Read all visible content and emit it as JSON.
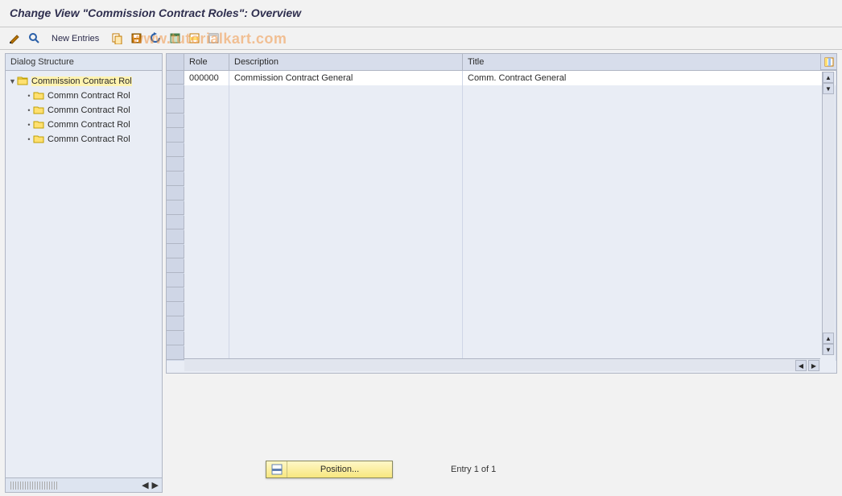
{
  "title": "Change View \"Commission Contract Roles\": Overview",
  "watermark": "www.tutorialkart.com",
  "toolbar": {
    "new_entries_label": "New Entries",
    "icons": {
      "toggle": "toggle-display-change-icon",
      "find": "find-icon",
      "copy": "copy-as-icon",
      "save": "save-icon",
      "undo": "undo-icon",
      "selectall": "select-all-icon",
      "selectblock": "select-block-icon",
      "deselect": "deselect-all-icon"
    }
  },
  "tree": {
    "header": "Dialog Structure",
    "root": {
      "label": "Commission Contract Rol",
      "expanded": true
    },
    "children": [
      {
        "label": "Commn Contract Rol"
      },
      {
        "label": "Commn Contract Rol"
      },
      {
        "label": "Commn Contract Rol"
      },
      {
        "label": "Commn Contract Rol"
      }
    ]
  },
  "grid": {
    "columns": {
      "role": "Role",
      "description": "Description",
      "title": "Title"
    },
    "rows": [
      {
        "role": "000000",
        "description": "Commission Contract General",
        "title": "Comm. Contract General"
      }
    ],
    "blank_row_count": 19
  },
  "footer": {
    "position_label": "Position...",
    "entry_text": "Entry 1 of 1"
  }
}
